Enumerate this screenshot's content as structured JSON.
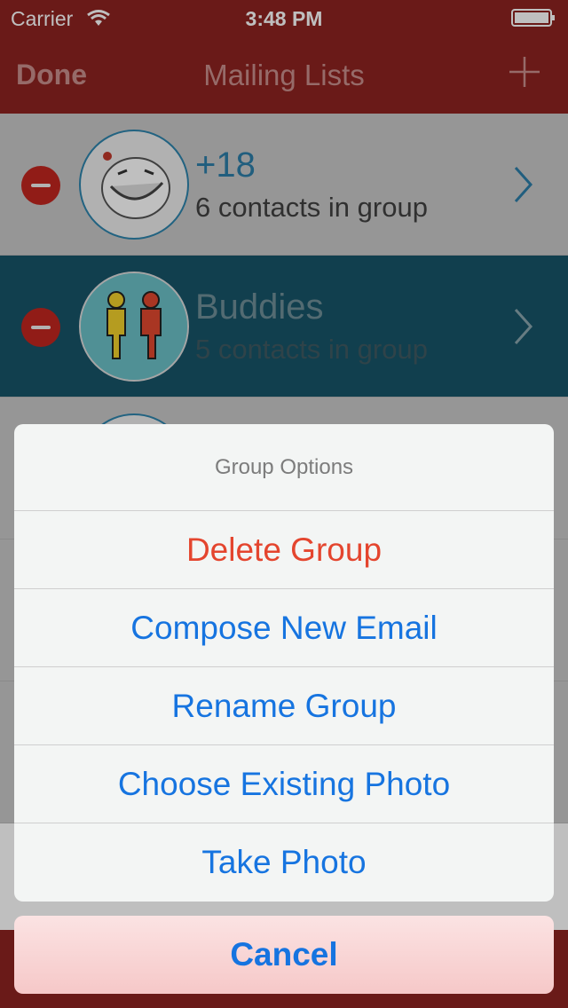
{
  "status": {
    "carrier": "Carrier",
    "time": "3:48 PM"
  },
  "nav": {
    "left": "Done",
    "title": "Mailing Lists",
    "right_icon": "plus-icon"
  },
  "groups": [
    {
      "title": "+18",
      "subtitle": "6 contacts in group"
    },
    {
      "title": "Buddies",
      "subtitle": "5 contacts in group"
    }
  ],
  "sheet": {
    "title": "Group Options",
    "buttons": [
      "Delete Group",
      "Compose New Email",
      "Rename Group",
      "Choose Existing Photo",
      "Take Photo"
    ],
    "cancel": "Cancel"
  },
  "colors": {
    "bar": "#8e2320",
    "selected": "#175468",
    "action": "#1674e0",
    "destructive": "#e4452e"
  }
}
